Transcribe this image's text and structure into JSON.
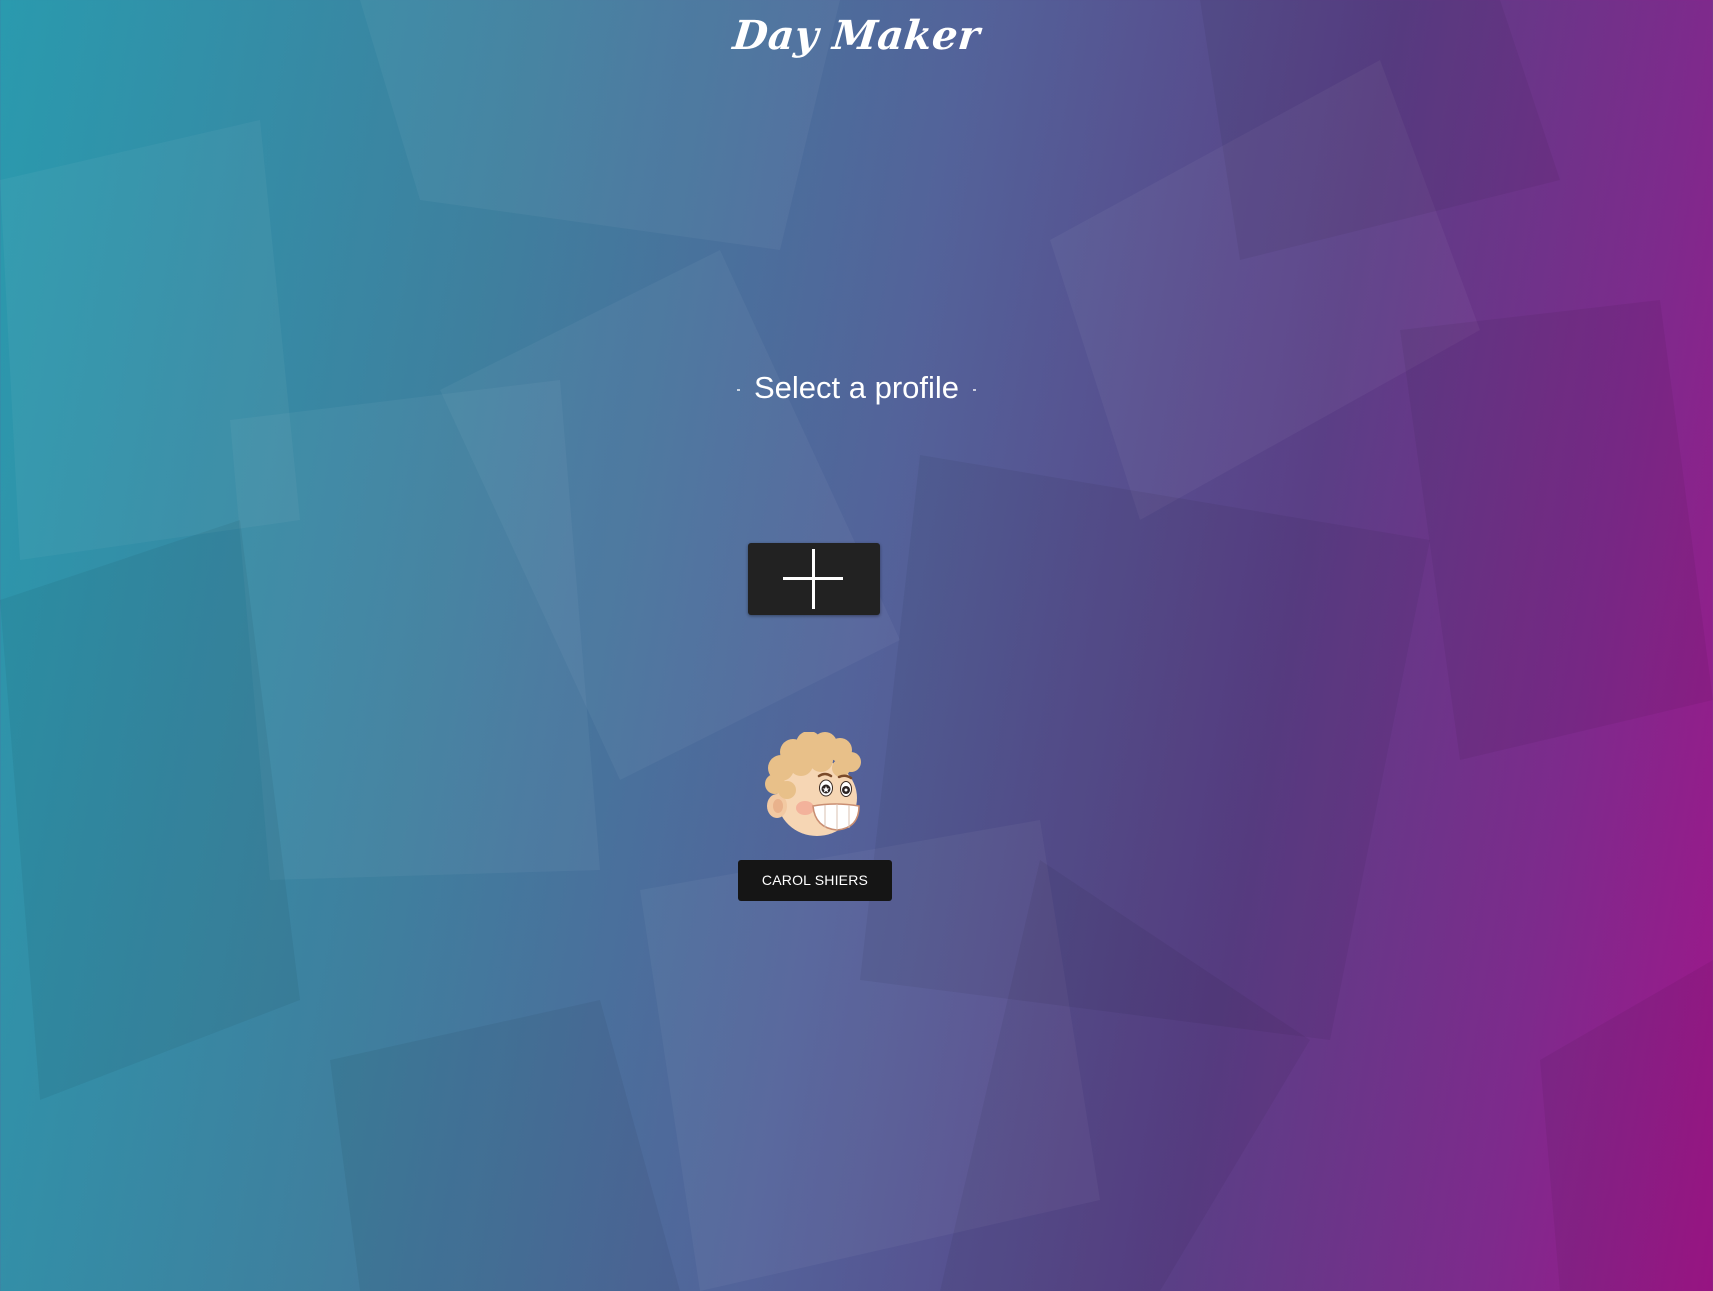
{
  "app": {
    "title": "Day Maker"
  },
  "main": {
    "prompt": "Select a profile",
    "add_profile_icon": "plus-icon",
    "profiles": [
      {
        "name": "CAROL SHIERS",
        "avatar_icon": "cartoon-boy-avatar"
      }
    ]
  },
  "colors": {
    "background_left": "#2a9aae",
    "background_center": "#53639a",
    "background_right": "#a0168a",
    "button_bg": "#222222",
    "name_bg": "#151515",
    "text": "#ffffff"
  }
}
